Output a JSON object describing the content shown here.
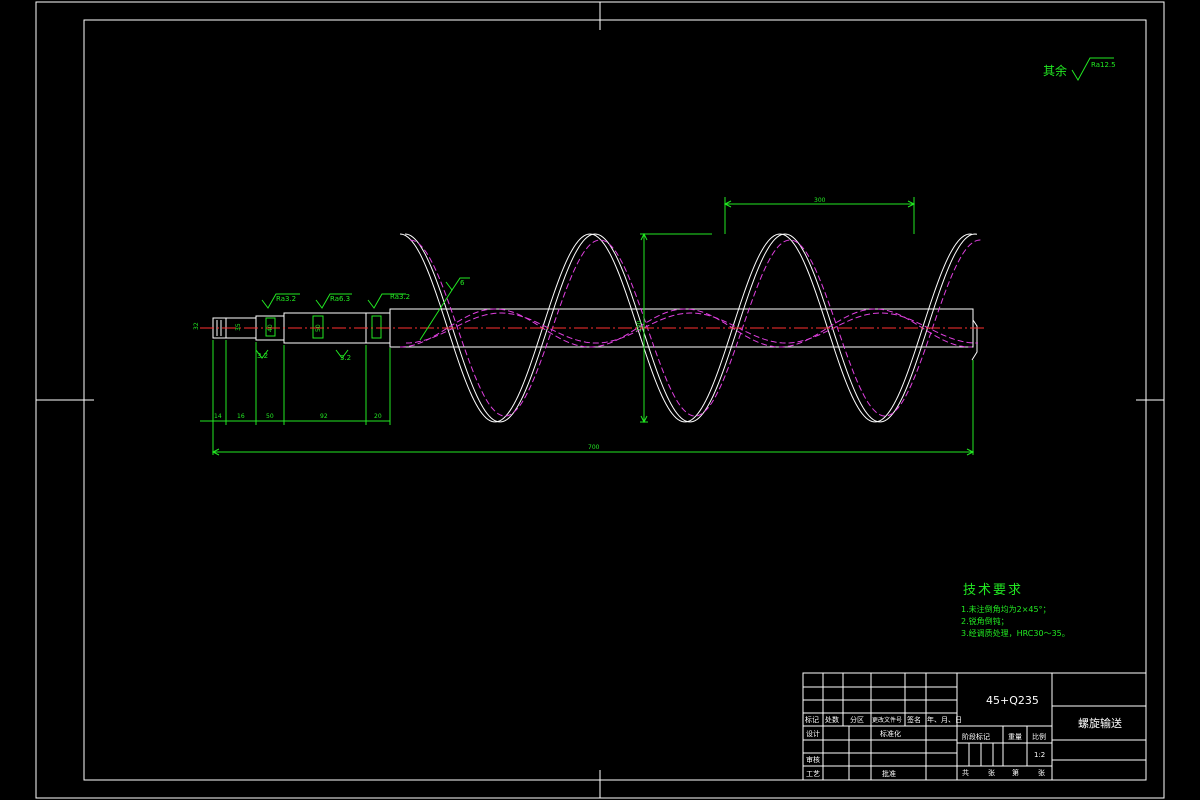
{
  "roughness": {
    "prefix": "其余",
    "value": "Ra12.5"
  },
  "drawing": {
    "surface_marks": [
      "Ra3.2",
      "Ra6.3",
      "Ra3.2",
      "6"
    ],
    "section_dims": [
      "3.2",
      "3.2"
    ],
    "chain_dims": [
      "14",
      "16",
      "50",
      "92",
      "20"
    ],
    "overall_length": "700",
    "pitch": "300",
    "flight_diameter": "290",
    "shaft_dims": [
      "32",
      "35",
      "40",
      "50"
    ]
  },
  "tech_req": {
    "title": "技术要求",
    "items": [
      "1.未注倒角均为2×45°；",
      "2.锐角倒钝；",
      "3.经调质处理，HRC30～35。"
    ]
  },
  "title_block": {
    "material": "45+Q235",
    "part_name": "螺旋输送",
    "header_labels": [
      "标记",
      "处数",
      "分区",
      "更改文件号",
      "签名",
      "年、月、日"
    ],
    "row_labels": [
      "设计",
      "审核",
      "工艺"
    ],
    "standardization": "标准化",
    "approve": "批准",
    "stage_label": "阶段标记",
    "weight_label": "重量",
    "scale_label": "比例",
    "scale_value": "1:2",
    "sheet_labels": [
      "共",
      "张",
      "第",
      "张"
    ]
  }
}
